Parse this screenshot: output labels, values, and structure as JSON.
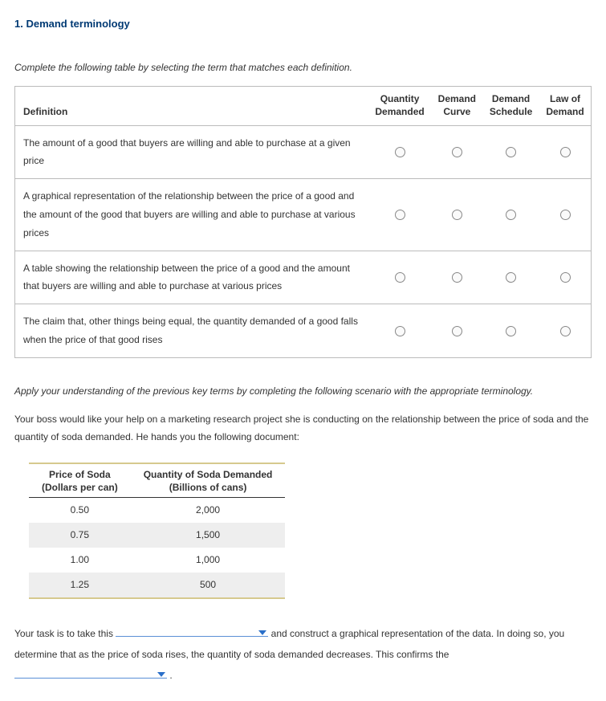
{
  "heading": "1. Demand terminology",
  "instruction1": "Complete the following table by selecting the term that matches each definition.",
  "table1": {
    "headers": {
      "definition": "Definition",
      "col1": "Quantity Demanded",
      "col2": "Demand Curve",
      "col3": "Demand Schedule",
      "col4": "Law of Demand"
    },
    "rows": [
      "The amount of a good that buyers are willing and able to purchase at a given price",
      "A graphical representation of the relationship between the price of a good and the amount of the good that buyers are willing and able to purchase at various prices",
      "A table showing the relationship between the price of a good and the amount that buyers are willing and able to purchase at various prices",
      "The claim that, other things being equal, the quantity demanded of a good falls when the price of that good rises"
    ]
  },
  "instruction2": "Apply your understanding of the previous key terms by completing the following scenario with the appropriate terminology.",
  "paragraph1": "Your boss would like your help on a marketing research project she is conducting on the relationship between the price of soda and the quantity of soda demanded. He hands you the following document:",
  "dataTable": {
    "col1Header": "Price of Soda",
    "col1Sub": "(Dollars per can)",
    "col2Header": "Quantity of Soda Demanded",
    "col2Sub": "(Billions of cans)",
    "rows": [
      {
        "price": "0.50",
        "qty": "2,000"
      },
      {
        "price": "0.75",
        "qty": "1,500"
      },
      {
        "price": "1.00",
        "qty": "1,000"
      },
      {
        "price": "1.25",
        "qty": "500"
      }
    ]
  },
  "sentence": {
    "part1": "Your task is to take this ",
    "part2": " and construct a graphical representation of the data. In doing so, you determine that as the price of soda rises, the quantity of soda demanded decreases. This confirms the ",
    "part3": " ."
  }
}
